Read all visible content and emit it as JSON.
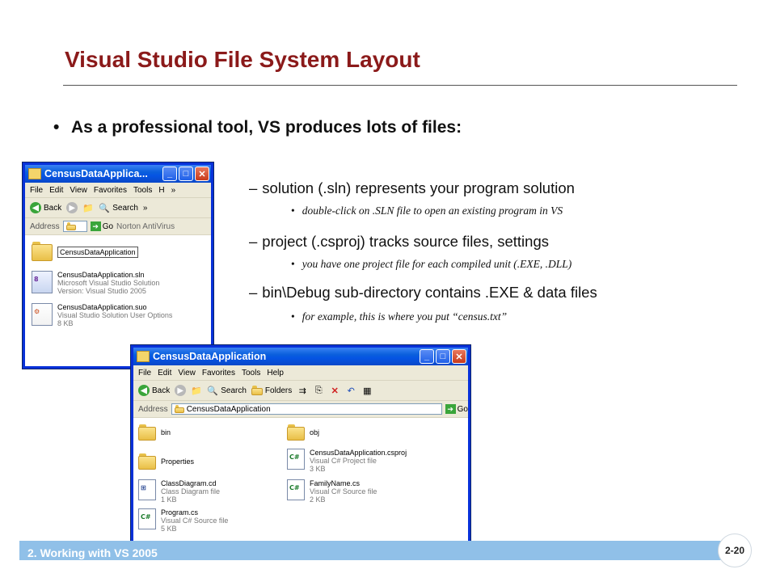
{
  "slide": {
    "title": "Visual Studio File System Layout",
    "bullet": "As a professional tool, VS produces lots of files:",
    "bullet_marker": "•",
    "points": [
      {
        "dash": "–",
        "text": "solution (.sln) represents your program solution",
        "sub": "double-click on .SLN file to open an existing program in VS"
      },
      {
        "dash": "–",
        "text": "project (.csproj) tracks source files, settings",
        "sub": "you have one project file for each compiled unit (.EXE, .DLL)"
      },
      {
        "dash": "–",
        "text": "bin\\Debug sub-directory contains .EXE & data files",
        "sub": "for example, this is where you put “census.txt”"
      }
    ],
    "sub_marker": "•",
    "footer": "2. Working with VS 2005",
    "page_number": "2-20"
  },
  "window1": {
    "title": "CensusDataApplica...",
    "menu": [
      "File",
      "Edit",
      "View",
      "Favorites",
      "Tools",
      "H"
    ],
    "chevron": "»",
    "toolbar": {
      "back": "Back",
      "search": "Search",
      "chevron": "»"
    },
    "address_label": "Address",
    "go_label": "Go",
    "av_label": "Norton AntiVirus",
    "items": [
      {
        "name": "CensusDataApplication",
        "line2": "",
        "line3": ""
      },
      {
        "name": "CensusDataApplication.sln",
        "line2": "Microsoft Visual Studio Solution",
        "line3": "Version: Visual Studio 2005"
      },
      {
        "name": "CensusDataApplication.suo",
        "line2": "Visual Studio Solution User Options",
        "line3": "8 KB"
      }
    ]
  },
  "window2": {
    "title": "CensusDataApplication",
    "menu": [
      "File",
      "Edit",
      "View",
      "Favorites",
      "Tools",
      "Help"
    ],
    "toolbar": {
      "back": "Back",
      "search": "Search",
      "folders": "Folders"
    },
    "address_label": "Address",
    "address_value": "CensusDataApplication",
    "go_label": "Go",
    "items": [
      {
        "name": "bin",
        "line2": "",
        "line3": ""
      },
      {
        "name": "obj",
        "line2": "",
        "line3": ""
      },
      {
        "name": "Properties",
        "line2": "",
        "line3": ""
      },
      {
        "name": "CensusDataApplication.csproj",
        "line2": "Visual C# Project file",
        "line3": "3 KB"
      },
      {
        "name": "ClassDiagram.cd",
        "line2": "Class Diagram file",
        "line3": "1 KB"
      },
      {
        "name": "FamilyName.cs",
        "line2": "Visual C# Source file",
        "line3": "2 KB"
      },
      {
        "name": "Program.cs",
        "line2": "Visual C# Source file",
        "line3": "5 KB"
      }
    ],
    "cs_icon_label": "C#"
  },
  "colors": {
    "title": "#8b1a1a",
    "footer_bar": "#90c0e8",
    "xp_title": "#0a5fdc"
  },
  "icons": [
    "folder-icon",
    "sln-file-icon",
    "suo-file-icon",
    "csproj-file-icon",
    "cd-file-icon",
    "cs-file-icon",
    "back-icon",
    "forward-icon",
    "up-icon",
    "search-icon",
    "folders-icon",
    "go-icon",
    "minimize-icon",
    "maximize-icon",
    "close-icon"
  ]
}
